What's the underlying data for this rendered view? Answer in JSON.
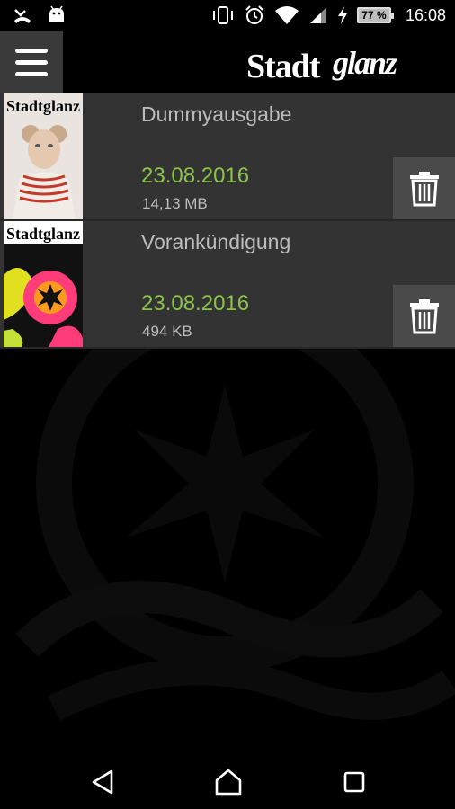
{
  "status_bar": {
    "time": "16:08",
    "battery": "77 %",
    "left_icons": [
      "missed-call-icon",
      "android-icon"
    ],
    "right_icons": [
      "vibrate-icon",
      "alarm-icon",
      "wifi-icon",
      "signal-icon",
      "charging-icon",
      "battery-icon"
    ]
  },
  "header": {
    "brand_part1": "Stadt",
    "brand_part2": "glanz",
    "menu_icon": "hamburger-menu-icon"
  },
  "issues": [
    {
      "title": "Dummyausgabe",
      "date": "23.08.2016",
      "size": "14,13 MB",
      "cover_brand": "Stadtglanz",
      "delete_icon": "trash-icon"
    },
    {
      "title": "Vorankündigung",
      "date": "23.08.2016",
      "size": "494 KB",
      "cover_brand": "Stadtglanz",
      "delete_icon": "trash-icon"
    }
  ],
  "nav_bar": {
    "icons": [
      "back-icon",
      "home-icon",
      "recents-icon"
    ]
  },
  "colors": {
    "accent_date": "#8bc34a",
    "row_background": "#333333",
    "delete_background": "#4a4a4a"
  }
}
